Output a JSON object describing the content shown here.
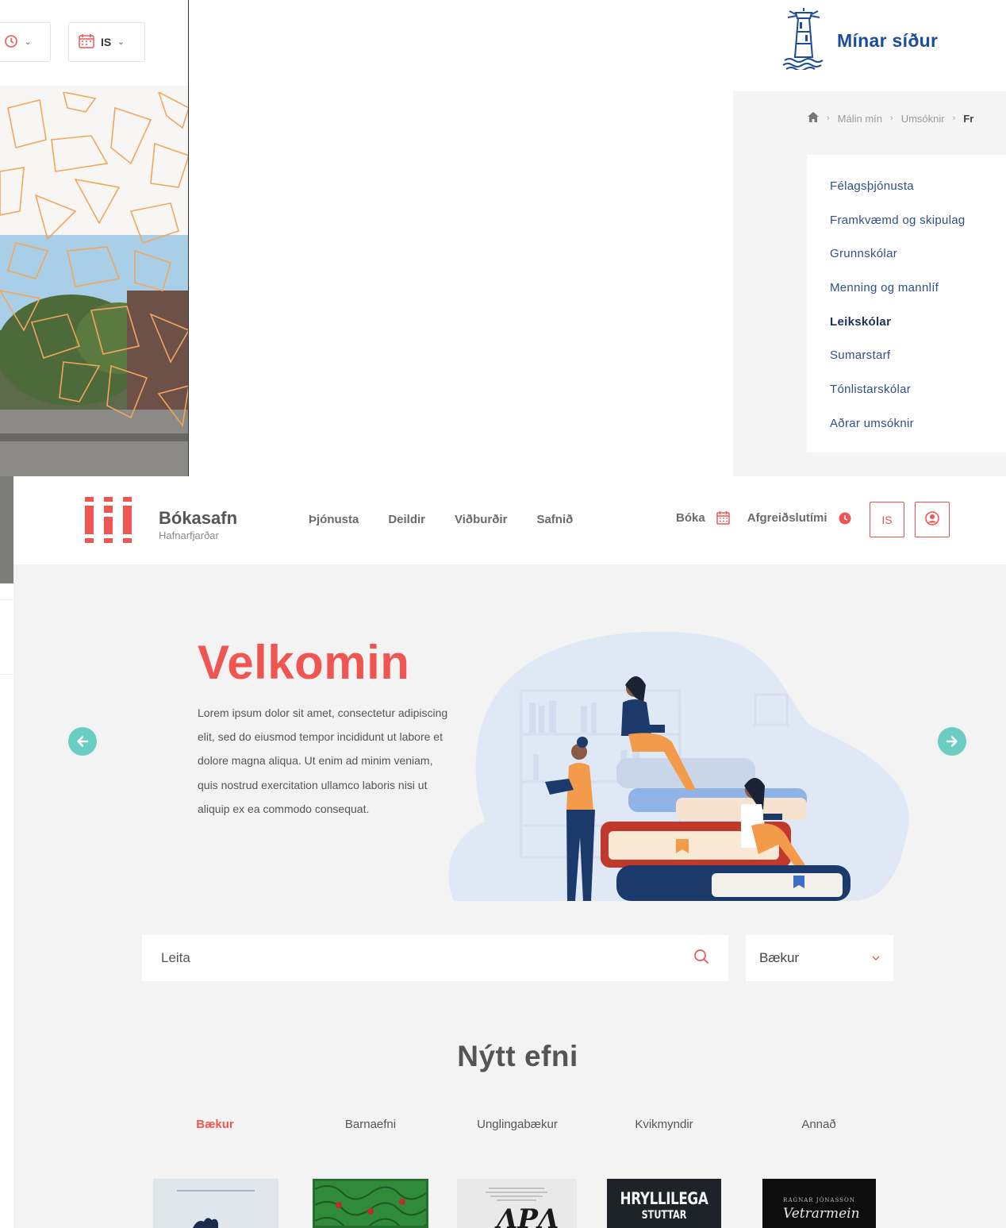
{
  "top_left": {
    "lang_button": "IS"
  },
  "top_right": {
    "title": "Mínar síður",
    "breadcrumb": [
      "Málin mín",
      "Umsóknir",
      "Fr"
    ],
    "menu": [
      {
        "label": "Félagsþjónusta",
        "active": false
      },
      {
        "label": "Framkvæmd og skipulag",
        "active": false
      },
      {
        "label": "Grunnskólar",
        "active": false
      },
      {
        "label": "Menning og mannlíf",
        "active": false
      },
      {
        "label": "Leikskólar",
        "active": true
      },
      {
        "label": "Sumarstarf",
        "active": false
      },
      {
        "label": "Tónlistarskólar",
        "active": false
      },
      {
        "label": "Aðrar umsóknir",
        "active": false
      }
    ]
  },
  "library": {
    "brand_name": "Bókasafn",
    "brand_sub": "Hafnarfjarðar",
    "nav": [
      "Þjónusta",
      "Deildir",
      "Viðburðir",
      "Safnið"
    ],
    "book_label": "Bóka",
    "hours_label": "Afgreiðslutími",
    "lang_button": "IS",
    "hero": {
      "title": "Velkomin",
      "text": "Lorem ipsum dolor sit amet, consectetur adipiscing elit, sed do eiusmod tempor incididunt ut labore et dolore magna aliqua. Ut enim ad minim veniam, quis nostrud exercitation ullamco laboris nisi ut aliquip ex ea commodo consequat."
    },
    "search": {
      "placeholder": "Leita",
      "category": "Bækur"
    },
    "new_content": {
      "title": "Nýtt efni",
      "tabs": [
        {
          "label": "Bækur",
          "active": true
        },
        {
          "label": "Barnaefni",
          "active": false
        },
        {
          "label": "Unglingabækur",
          "active": false
        },
        {
          "label": "Kvikmyndir",
          "active": false
        },
        {
          "label": "Annað",
          "active": false
        }
      ],
      "book_covers": [
        {
          "title": "",
          "color": "#dfe6ec"
        },
        {
          "title": "",
          "color": "#2f8a3a"
        },
        {
          "title": "",
          "color": "#e9e9e9"
        },
        {
          "title": "HRYLLILEGA",
          "subtitle": "STUTTAR",
          "color": "#1d2328"
        },
        {
          "title": "Vetrarmein",
          "author": "RAGNAR JÓNASSON",
          "color": "#0d0d0d"
        }
      ]
    }
  },
  "colors": {
    "accent_red": "#ef5652",
    "teal": "#69cdc1",
    "navy": "#1d4c9a",
    "orange_lines": "#f3a65a"
  }
}
